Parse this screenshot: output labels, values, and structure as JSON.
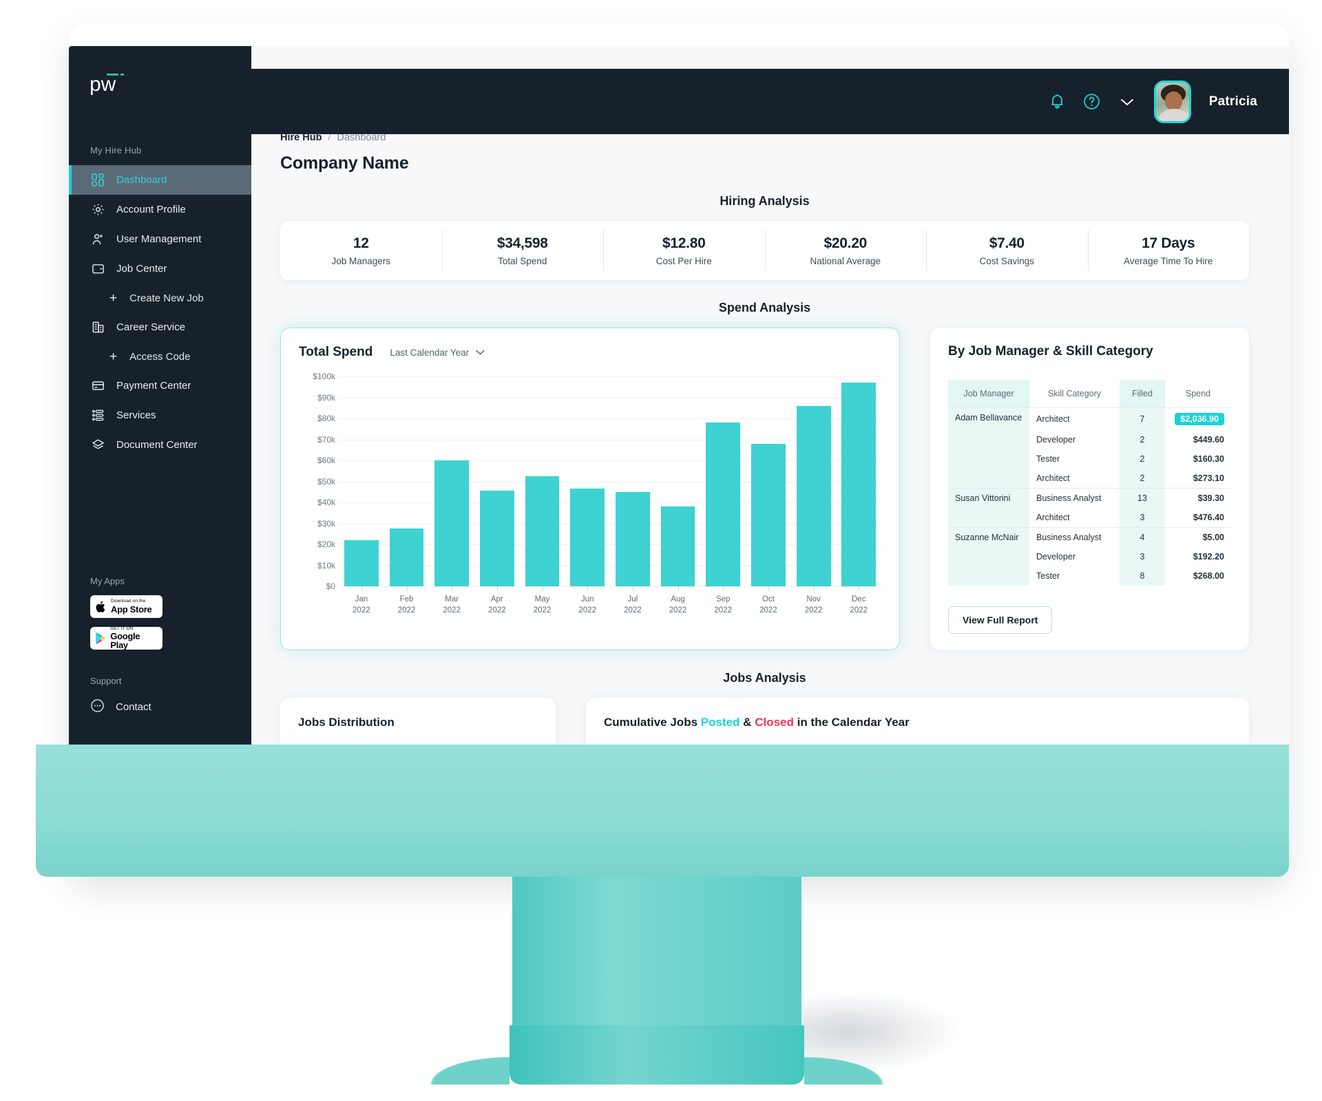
{
  "brand": {
    "logo_text": "pw",
    "accent": "#19d5d5",
    "dark": "#17212b"
  },
  "topbar": {
    "notifications_icon": "bell-icon",
    "help_icon": "question-circle-icon",
    "chevron_icon": "chevron-down-icon",
    "user_name": "Patricia"
  },
  "sidebar": {
    "section_label": "My Hire Hub",
    "items": [
      {
        "label": "Dashboard",
        "icon": "dashboard-grid-icon",
        "active": true
      },
      {
        "label": "Account Profile",
        "icon": "gear-icon",
        "active": false
      },
      {
        "label": "User Management",
        "icon": "user-plus-icon",
        "active": false
      },
      {
        "label": "Job Center",
        "icon": "wallet-icon",
        "active": false
      }
    ],
    "sub_create_job": {
      "label": "Create New Job",
      "icon": "plus-icon"
    },
    "career_service": {
      "label": "Career Service",
      "icon": "building-icon"
    },
    "sub_access_code": {
      "label": "Access Code",
      "icon": "plus-icon"
    },
    "items2": [
      {
        "label": "Payment Center",
        "icon": "credit-card-icon"
      },
      {
        "label": "Services",
        "icon": "list-bullets-icon"
      },
      {
        "label": "Document Center",
        "icon": "layers-icon"
      }
    ],
    "apps_label": "My Apps",
    "app_store": {
      "small": "Download on the",
      "large": "App Store",
      "icon": "apple-icon"
    },
    "google_play": {
      "small": "GET IT ON",
      "large": "Google Play",
      "icon": "google-play-icon"
    },
    "support_label": "Support",
    "contact": {
      "label": "Contact",
      "icon": "chat-dots-icon"
    }
  },
  "breadcrumb": {
    "root": "Hire Hub",
    "separator": "/",
    "current": "Dashboard"
  },
  "page_title": "Company Name",
  "sections": {
    "hiring_analysis": "Hiring Analysis",
    "spend_analysis": "Spend Analysis",
    "jobs_analysis": "Jobs Analysis"
  },
  "kpis": [
    {
      "value": "12",
      "label": "Job Managers"
    },
    {
      "value": "$34,598",
      "label": "Total Spend"
    },
    {
      "value": "$12.80",
      "label": "Cost Per Hire"
    },
    {
      "value": "$20.20",
      "label": "National Average"
    },
    {
      "value": "$7.40",
      "label": "Cost Savings"
    },
    {
      "value": "17 Days",
      "label": "Average Time To Hire"
    }
  ],
  "spend_chart": {
    "title": "Total Spend",
    "range_selector": "Last Calendar Year",
    "chevron_icon": "chevron-down-icon"
  },
  "chart_data": {
    "type": "bar",
    "title": "Total Spend",
    "xlabel": "",
    "ylabel": "",
    "ylim": [
      0,
      100000
    ],
    "grid": true,
    "legend": "none",
    "bar_color": "#3ed2d2",
    "categories": [
      "Jan\n2022",
      "Feb\n2022",
      "Mar\n2022",
      "Apr\n2022",
      "May\n2022",
      "Jun\n2022",
      "Jul\n2022",
      "Aug\n2022",
      "Sep\n2022",
      "Oct\n2022",
      "Nov\n2022",
      "Dec\n2022"
    ],
    "category_months": [
      "Jan",
      "Feb",
      "Mar",
      "Apr",
      "May",
      "Jun",
      "Jul",
      "Aug",
      "Sep",
      "Oct",
      "Nov",
      "Dec"
    ],
    "category_years": [
      "2022",
      "2022",
      "2022",
      "2022",
      "2022",
      "2022",
      "2022",
      "2022",
      "2022",
      "2022",
      "2022",
      "2022"
    ],
    "values": [
      22000,
      27500,
      60000,
      45500,
      52500,
      46500,
      45000,
      38000,
      78000,
      68000,
      86000,
      97000
    ],
    "ytick_labels": [
      "$100k",
      "$90k",
      "$80k",
      "$70k",
      "$60k",
      "$50k",
      "$40k",
      "$30k",
      "$20k",
      "$10k",
      "$0"
    ],
    "ytick_values": [
      100000,
      90000,
      80000,
      70000,
      60000,
      50000,
      40000,
      30000,
      20000,
      10000,
      0
    ]
  },
  "report_table": {
    "title": "By Job Manager & Skill Category",
    "columns": [
      "Job Manager",
      "Skill Category",
      "Filled",
      "Spend"
    ],
    "groups": [
      {
        "manager": "Adam Bellavance",
        "rows": [
          {
            "skill": "Architect",
            "filled": "7",
            "spend": "$2,036.90",
            "highlight": true
          },
          {
            "skill": "Developer",
            "filled": "2",
            "spend": "$449.60",
            "highlight": false
          },
          {
            "skill": "Tester",
            "filled": "2",
            "spend": "$160.30",
            "highlight": false
          },
          {
            "skill": "Architect",
            "filled": "2",
            "spend": "$273.10",
            "highlight": false
          }
        ]
      },
      {
        "manager": "Susan Vittorini",
        "rows": [
          {
            "skill": "Business Analyst",
            "filled": "13",
            "spend": "$39.30",
            "highlight": false
          },
          {
            "skill": "Architect",
            "filled": "3",
            "spend": "$476.40",
            "highlight": false
          }
        ]
      },
      {
        "manager": "Suzanne McNair",
        "rows": [
          {
            "skill": "Business Analyst",
            "filled": "4",
            "spend": "$5.00",
            "highlight": false
          },
          {
            "skill": "Developer",
            "filled": "3",
            "spend": "$192.20",
            "highlight": false
          },
          {
            "skill": "Tester",
            "filled": "8",
            "spend": "$268.00",
            "highlight": false
          }
        ]
      }
    ],
    "view_report_label": "View Full Report"
  },
  "jobs_distribution": {
    "title": "Jobs Distribution"
  },
  "cumulative_jobs": {
    "prefix": "Cumulative Jobs ",
    "posted": "Posted",
    "amp": " & ",
    "closed": "Closed",
    "suffix": " in the Calendar Year"
  }
}
